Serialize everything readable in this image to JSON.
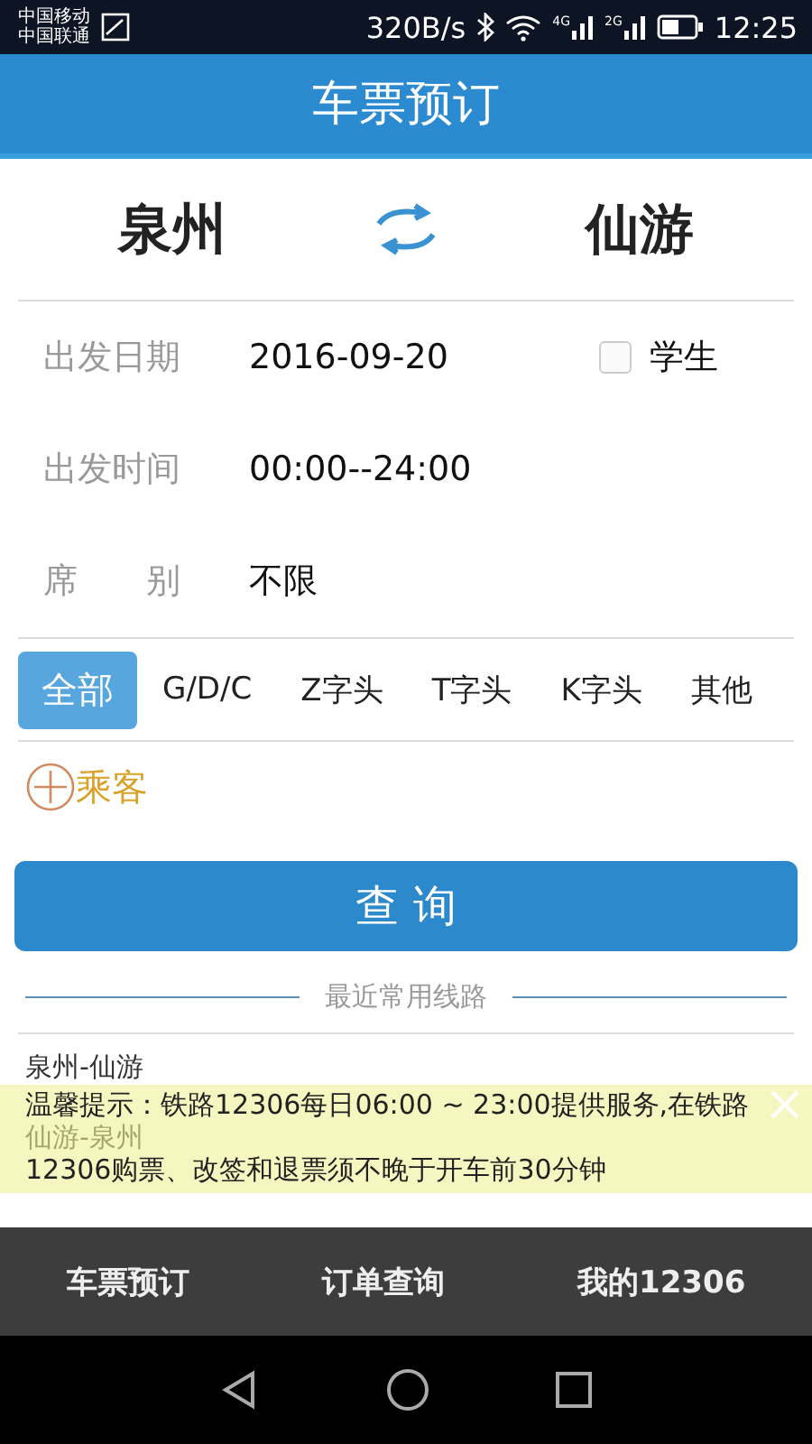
{
  "status_bar": {
    "carriers": [
      "中国移动",
      "中国联通"
    ],
    "speed": "320B/s",
    "network_labels": [
      "4G",
      "2G"
    ],
    "time": "12:25"
  },
  "header": {
    "title": "车票预订"
  },
  "route": {
    "from": "泉州",
    "to": "仙游"
  },
  "fields": [
    {
      "label": "出发日期",
      "value": "2016-09-20"
    },
    {
      "label": "出发时间",
      "value": "00:00--24:00"
    },
    {
      "label": "席　　别",
      "value": "不限"
    }
  ],
  "student": {
    "label": "学生",
    "checked": false
  },
  "train_types": [
    {
      "label": "全部",
      "selected": true
    },
    {
      "label": "G/D/C",
      "selected": false
    },
    {
      "label": "Z字头",
      "selected": false
    },
    {
      "label": "T字头",
      "selected": false
    },
    {
      "label": "K字头",
      "selected": false
    },
    {
      "label": "其他",
      "selected": false
    }
  ],
  "add_passenger": "乘客",
  "search_button": "查 询",
  "recent": {
    "title": "最近常用线路",
    "routes": [
      "泉州-仙游",
      "仙游-泉州"
    ]
  },
  "notice": {
    "lines": [
      "温馨提示：铁路12306每日06:00 ~ 23:00提供服务,在铁路",
      "12306购票、改签和退票须不晚于开车前30分钟"
    ]
  },
  "bottom_tabs": [
    {
      "label": "车票预订"
    },
    {
      "label": "订单查询"
    },
    {
      "label": "我的12306"
    }
  ]
}
